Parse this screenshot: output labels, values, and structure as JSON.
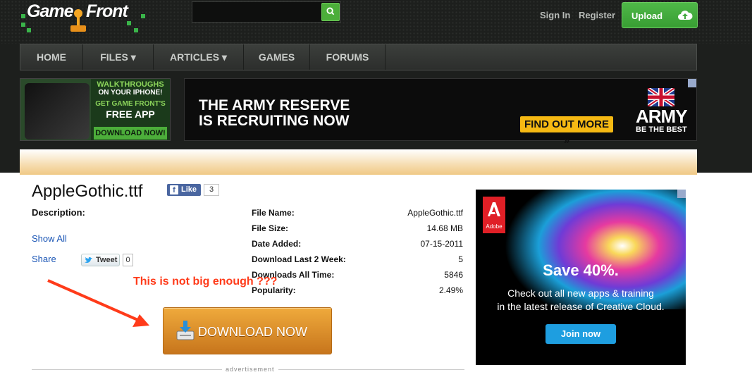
{
  "header": {
    "logo_left": "Game",
    "logo_right": "Front",
    "sign_in": "Sign In",
    "register": "Register",
    "upload": "Upload"
  },
  "nav": {
    "items": [
      {
        "label": "HOME"
      },
      {
        "label": "FILES ▾"
      },
      {
        "label": "ARTICLES ▾"
      },
      {
        "label": "GAMES"
      },
      {
        "label": "FORUMS"
      }
    ]
  },
  "app_ad": {
    "line1": "WALKTHROUGHS",
    "line2": "ON YOUR IPHONE!",
    "line3": "GET GAME FRONT'S",
    "line4": "FREE APP",
    "cta": "DOWNLOAD NOW!"
  },
  "army_ad": {
    "headline1": "THE ARMY RESERVE",
    "headline2": "IS RECRUITING NOW",
    "cta": "FIND OUT MORE »",
    "brand": "ARMY",
    "tagline": "BE THE BEST"
  },
  "file": {
    "title": "AppleGothic.ttf",
    "like_label": "Like",
    "like_count": "3",
    "description_label": "Description:",
    "show_all": "Show All",
    "share": "Share",
    "tweet_label": "Tweet",
    "tweet_count": "0",
    "info": [
      {
        "key": "File Name:",
        "value": "AppleGothic.ttf"
      },
      {
        "key": "File Size:",
        "value": "14.68 MB"
      },
      {
        "key": "Date Added:",
        "value": "07-15-2011"
      },
      {
        "key": "Download Last 2 Week:",
        "value": "5"
      },
      {
        "key": "Downloads All Time:",
        "value": "5846"
      },
      {
        "key": "Popularity:",
        "value": "2.49%"
      }
    ],
    "download_label": "DOWNLOAD NOW",
    "advertisement_label": "advertisement"
  },
  "annotation": "This is not big enough ???",
  "adobe_ad": {
    "brand": "Adobe",
    "headline": "Save 40%.",
    "copy1": "Check out all new apps & training",
    "copy2": "in the latest release of Creative Cloud.",
    "cta": "Join now"
  },
  "colors": {
    "accent_green": "#4cae3a",
    "download_orange": "#e09a35",
    "annotation_red": "#ff3b1a",
    "link_blue": "#1a55b5"
  }
}
